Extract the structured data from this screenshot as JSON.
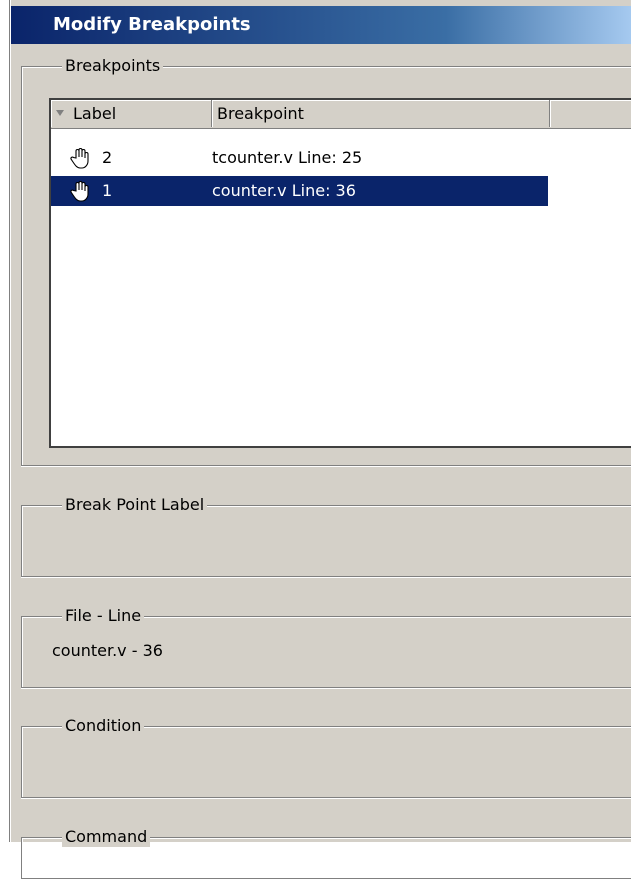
{
  "window": {
    "title": "Modify Breakpoints"
  },
  "breakpoints_group": {
    "legend": "Breakpoints"
  },
  "table": {
    "columns": [
      "Label",
      "Breakpoint",
      ""
    ],
    "rows": [
      {
        "icon": "hand-icon",
        "label": "2",
        "breakpoint": "tcounter.v Line: 25",
        "selected": false
      },
      {
        "icon": "hand-icon",
        "label": "1",
        "breakpoint": "counter.v Line: 36",
        "selected": true
      }
    ]
  },
  "label_group": {
    "legend": "Break Point Label",
    "value": ""
  },
  "file_line_group": {
    "legend": "File - Line",
    "value": "counter.v - 36"
  },
  "condition_group": {
    "legend": "Condition",
    "value": ""
  },
  "command_group": {
    "legend": "Command"
  },
  "colors": {
    "title_start": "#0a246a",
    "selection": "#0a246a",
    "face": "#d4d0c8"
  }
}
